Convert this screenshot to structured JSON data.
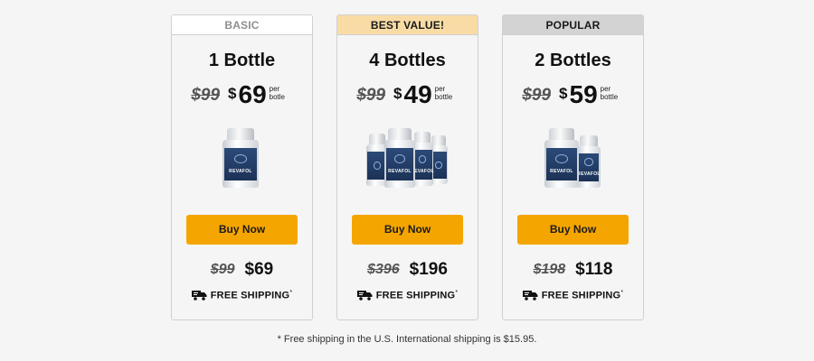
{
  "offers": [
    {
      "badge": "BASIC",
      "quantity": "1 Bottle",
      "old_unit_price": "$99",
      "currency": "$",
      "unit_price": "69",
      "per_label_1": "per",
      "per_label_2": "botle",
      "bottle_count": 1,
      "button": "Buy Now",
      "old_total": "$99",
      "total": "$69",
      "shipping": "FREE SHIPPING",
      "shipping_mark": "*"
    },
    {
      "badge": "BEST VALUE!",
      "quantity": "4 Bottles",
      "old_unit_price": "$99",
      "currency": "$",
      "unit_price": "49",
      "per_label_1": "per",
      "per_label_2": "bottle",
      "bottle_count": 4,
      "button": "Buy Now",
      "old_total": "$396",
      "total": "$196",
      "shipping": "FREE SHIPPING",
      "shipping_mark": "*"
    },
    {
      "badge": "POPULAR",
      "quantity": "2 Bottles",
      "old_unit_price": "$99",
      "currency": "$",
      "unit_price": "59",
      "per_label_1": "per",
      "per_label_2": "bottle",
      "bottle_count": 2,
      "button": "Buy Now",
      "old_total": "$198",
      "total": "$118",
      "shipping": "FREE SHIPPING",
      "shipping_mark": "*"
    }
  ],
  "product_label": "REVAFOL",
  "footnote": "* Free shipping in the U.S. International shipping is $15.95.",
  "colors": {
    "button": "#f5a500",
    "best_value_badge": "#f9dca5",
    "popular_badge": "#d3d3d3",
    "label_blue": "#1c3257"
  },
  "icons": {
    "shipping": "truck-icon"
  }
}
